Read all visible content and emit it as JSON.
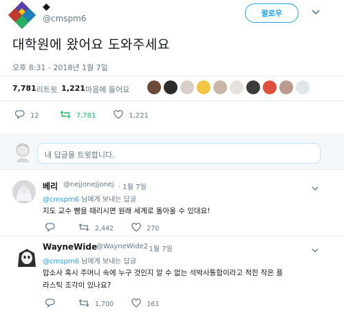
{
  "tweet": {
    "display_name": "◆",
    "handle": "@cmspm6",
    "follow_label": "팔로우",
    "text": "대학원에 왔어요 도와주세요",
    "timestamp": "오후 8:31 - 2018년 1월 7일",
    "retweets_count": "7,781",
    "retweets_label": " 리트윗 ",
    "likes_count": "1,221",
    "likes_label": " 마음에 들어요",
    "actions": {
      "replies": "12",
      "retweets": "7,781",
      "likes": "1,221"
    }
  },
  "composer": {
    "placeholder": "내 답글을 트윗합니다."
  },
  "replies": [
    {
      "name": "베리",
      "handle": "@nejjonejjonej",
      "date": "· 1월 7일",
      "reply_to_handle": "@cmspm6",
      "reply_to_suffix": " 님에게 보내는 답글",
      "text": "지도 교수 뺨을 때리시면 원래 세계로 돌아올 수 있대요!",
      "actions": {
        "retweets": "2,442",
        "likes": "270"
      }
    },
    {
      "name": "WayneWide",
      "handle": "@WayneWide2",
      "date": "· 1월 7일",
      "reply_to_handle": "@cmspm6",
      "reply_to_suffix": " 님에게 보내는 답글",
      "text_line1": "맙소사 혹시 주머니 속에 누구 것인지 알 수 없는 석박사통합이라고 적힌 작은 플",
      "text_line2": "라스틱 조각이 있나요?",
      "actions": {
        "retweets": "1,700",
        "likes": "161"
      }
    }
  ],
  "colors": {
    "accent": "#1da1f2",
    "retweet": "#17bf63",
    "muted": "#657786",
    "border": "#e6ecf0"
  },
  "icons": [
    "diamond-logo-icon",
    "chevron-down-icon",
    "reply-icon",
    "retweet-icon",
    "heart-icon",
    "caret-icon"
  ]
}
